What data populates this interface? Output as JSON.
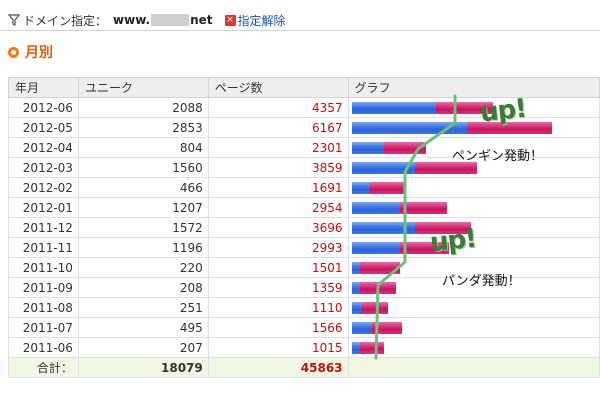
{
  "filter": {
    "icon": "filter-icon",
    "label": "ドメイン指定：",
    "domain_prefix": "www.",
    "domain_suffix": "net",
    "clear_label": "指定解除"
  },
  "section": {
    "title": "月別"
  },
  "table": {
    "headers": [
      "年月",
      "ユニーク",
      "ページ数",
      "グラフ"
    ],
    "rows": [
      {
        "month": "2012-06",
        "unique": "2088",
        "pageviews": "4357"
      },
      {
        "month": "2012-05",
        "unique": "2853",
        "pageviews": "6167"
      },
      {
        "month": "2012-04",
        "unique": "804",
        "pageviews": "2301"
      },
      {
        "month": "2012-03",
        "unique": "1560",
        "pageviews": "3859"
      },
      {
        "month": "2012-02",
        "unique": "466",
        "pageviews": "1691"
      },
      {
        "month": "2012-01",
        "unique": "1207",
        "pageviews": "2954"
      },
      {
        "month": "2011-12",
        "unique": "1572",
        "pageviews": "3696"
      },
      {
        "month": "2011-11",
        "unique": "1196",
        "pageviews": "2993"
      },
      {
        "month": "2011-10",
        "unique": "220",
        "pageviews": "1501"
      },
      {
        "month": "2011-09",
        "unique": "208",
        "pageviews": "1359"
      },
      {
        "month": "2011-08",
        "unique": "251",
        "pageviews": "1110"
      },
      {
        "month": "2011-07",
        "unique": "495",
        "pageviews": "1566"
      },
      {
        "month": "2011-06",
        "unique": "207",
        "pageviews": "1015"
      }
    ],
    "total": {
      "label": "合計：",
      "unique": "18079",
      "pageviews": "45863"
    }
  },
  "annotations": {
    "up_top": "up!",
    "up_bottom": "up!",
    "penguin": "ペンギン発動！",
    "panda": "パンダ発動！"
  },
  "colors": {
    "accent": "#e05a10",
    "unique_bar": "#2a62d8",
    "pageview_bar": "#c4145e",
    "pageview_text": "#c01010",
    "annotation_line": "#6cbf7d",
    "total_row": "#eef7e2"
  }
}
